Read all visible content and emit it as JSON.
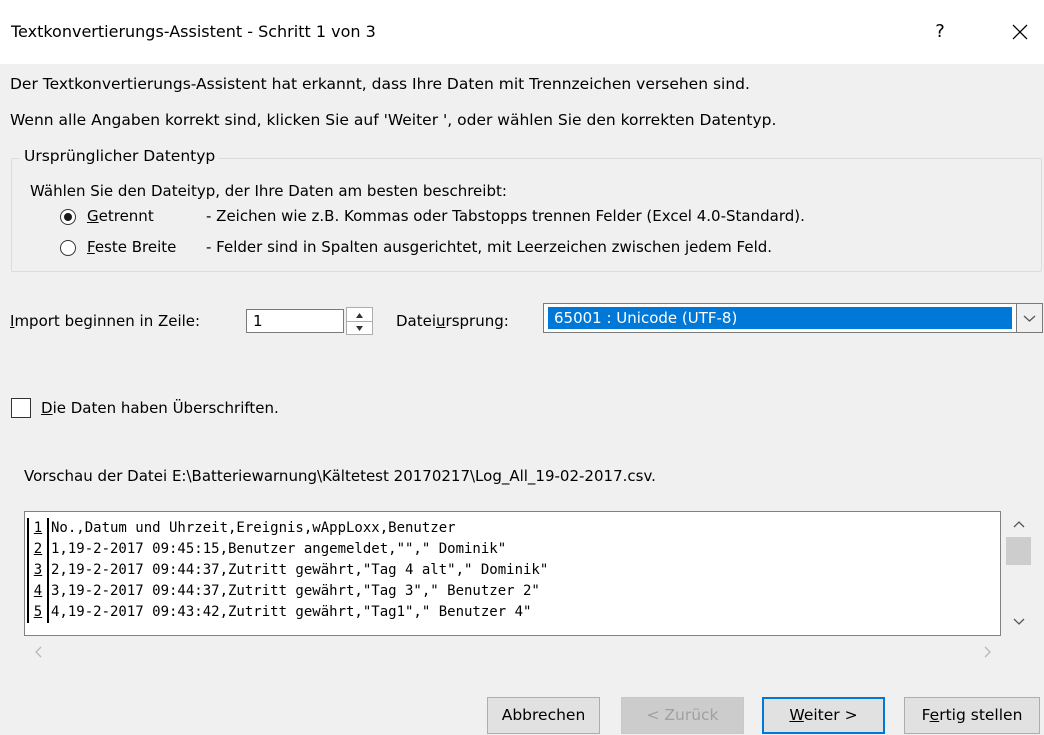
{
  "window": {
    "title": "Textkonvertierungs-Assistent - Schritt 1 von 3",
    "help_label": "?"
  },
  "intro": {
    "line1": "Der Textkonvertierungs-Assistent hat erkannt, dass Ihre Daten mit Trennzeichen versehen sind.",
    "line2": "Wenn alle Angaben korrekt sind, klicken Sie auf 'Weiter ', oder wählen Sie den korrekten Datentyp."
  },
  "group": {
    "legend": "Ursprünglicher Datentyp",
    "instruction": "Wählen Sie den Dateityp, der Ihre Daten am besten beschreibt:",
    "options": [
      {
        "key": "G",
        "rest": "etrennt",
        "description": "- Zeichen wie z.B. Kommas oder Tabstopps trennen Felder (Excel 4.0-Standard).",
        "checked": true
      },
      {
        "key": "F",
        "rest": "este Breite",
        "description": "- Felder sind in Spalten ausgerichtet, mit Leerzeichen zwischen jedem Feld.",
        "checked": false
      }
    ]
  },
  "import_row": {
    "label_key": "I",
    "label_rest": "mport beginnen in Zeile:",
    "value": "1"
  },
  "origin": {
    "label_pre": "Datei",
    "label_key": "u",
    "label_rest": "rsprung:",
    "value": "65001 : Unicode (UTF-8)"
  },
  "headers_checkbox": {
    "label_key": "D",
    "label_rest": "ie Daten haben Überschriften.",
    "checked": false
  },
  "preview": {
    "label": "Vorschau der Datei E:\\Batteriewarnung\\Kältetest 20170217\\Log_All_19-02-2017.csv.",
    "rows": [
      {
        "num": "1",
        "text": "No.,Datum und Uhrzeit,Ereignis,wAppLoxx,Benutzer"
      },
      {
        "num": "2",
        "text": "1,19-2-2017 09:45:15,Benutzer angemeldet,\"\",\" Dominik\""
      },
      {
        "num": "3",
        "text": "2,19-2-2017 09:44:37,Zutritt gewährt,\"Tag 4 alt\",\" Dominik\""
      },
      {
        "num": "4",
        "text": "3,19-2-2017 09:44:37,Zutritt gewährt,\"Tag 3\",\" Benutzer 2\""
      },
      {
        "num": "5",
        "text": "4,19-2-2017 09:43:42,Zutritt gewährt,\"Tag1\",\" Benutzer 4\""
      }
    ]
  },
  "buttons": {
    "cancel": "Abbrechen",
    "back": "< Zurück",
    "next_key": "W",
    "next_rest": "eiter >",
    "finish_pre": "F",
    "finish_key": "e",
    "finish_rest": "rtig stellen"
  },
  "colors": {
    "selection": "#0078d7",
    "background": "#f0f0f0",
    "default_button_border": "#0078d7"
  }
}
